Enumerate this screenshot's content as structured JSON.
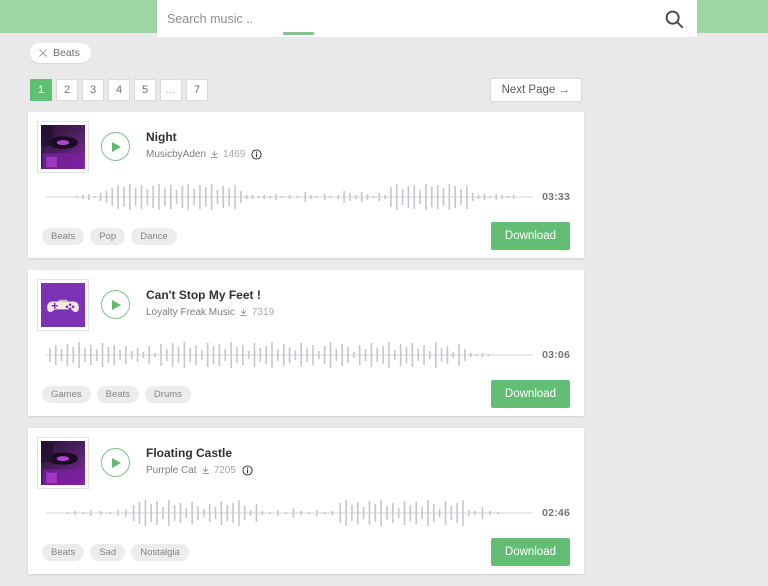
{
  "header": {
    "search": {
      "placeholder": "Search music ..",
      "value": "",
      "icon": "search-icon"
    },
    "band_color": "#9ed5a4",
    "underline_color": "#86c48f"
  },
  "filters": {
    "chips": [
      {
        "label": "Beats",
        "remove_icon": "close-icon"
      }
    ]
  },
  "pagination": {
    "pages": [
      {
        "label": "1",
        "active": true
      },
      {
        "label": "2",
        "active": false
      },
      {
        "label": "3",
        "active": false
      },
      {
        "label": "4",
        "active": false
      },
      {
        "label": "5",
        "active": false
      },
      {
        "label": "...",
        "active": false
      },
      {
        "label": "7",
        "active": false
      }
    ],
    "next_label": "Next Page →",
    "active_color": "#61bf72"
  },
  "accent_color": "#63bd74",
  "tracks": [
    {
      "title": "Night",
      "artist": "MusicbyAden",
      "downloads": "1469",
      "duration": "03:33",
      "tags": [
        "Beats",
        "Pop",
        "Dance"
      ],
      "download_label": "Download",
      "has_info_icon": true,
      "thumbnail": "turntable",
      "play_icon": "play-icon",
      "download_count_icon": "download-icon",
      "info_icon": "info-icon"
    },
    {
      "title": "Can't Stop My Feet !",
      "artist": "Loyalty Freak Music",
      "downloads": "7319",
      "duration": "03:06",
      "tags": [
        "Games",
        "Beats",
        "Drums"
      ],
      "download_label": "Download",
      "has_info_icon": false,
      "thumbnail": "gamepad",
      "play_icon": "play-icon",
      "download_count_icon": "download-icon",
      "info_icon": "info-icon"
    },
    {
      "title": "Floating Castle",
      "artist": "Purrple Cat",
      "downloads": "7205",
      "duration": "02:46",
      "tags": [
        "Beats",
        "Sad",
        "Nostalgia"
      ],
      "download_label": "Download",
      "has_info_icon": true,
      "thumbnail": "turntable",
      "play_icon": "play-icon",
      "download_count_icon": "download-icon",
      "info_icon": "info-icon"
    }
  ]
}
